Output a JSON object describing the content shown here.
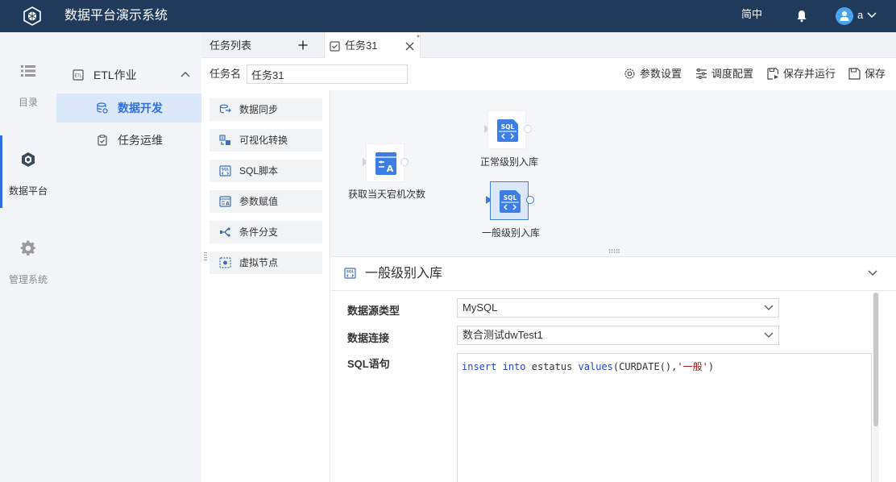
{
  "header": {
    "app_title": "数据平台演示系统",
    "language": "简中",
    "user_name": "a",
    "bg_color": "#1f3a5a"
  },
  "rail": {
    "items": [
      {
        "label": "目录",
        "icon": "list-icon",
        "active": false
      },
      {
        "label": "数据平台",
        "icon": "cube-icon",
        "active": true
      },
      {
        "label": "管理系统",
        "icon": "gear-icon",
        "active": false
      }
    ]
  },
  "sidebar": {
    "group_label": "ETL作业",
    "items": [
      {
        "label": "数据开发",
        "icon": "database-icon",
        "active": true
      },
      {
        "label": "任务运维",
        "icon": "clipboard-icon",
        "active": false
      }
    ]
  },
  "tabs": {
    "list_label": "任务列表",
    "active_tab_label": "任务31",
    "dirty_marker": "*"
  },
  "task": {
    "name_label": "任务名",
    "name_value": "任务31"
  },
  "toolbar": {
    "params_label": "参数设置",
    "schedule_label": "调度配置",
    "save_run_label": "保存并运行",
    "save_label": "保存"
  },
  "palette": {
    "items": [
      {
        "label": "数据同步",
        "icon": "sync-icon"
      },
      {
        "label": "可视化转换",
        "icon": "transform-icon"
      },
      {
        "label": "SQL脚本",
        "icon": "sql-icon"
      },
      {
        "label": "参数赋值",
        "icon": "param-assign-icon"
      },
      {
        "label": "条件分支",
        "icon": "branch-icon"
      },
      {
        "label": "虚拟节点",
        "icon": "virtual-node-icon"
      }
    ]
  },
  "canvas": {
    "nodes": [
      {
        "label": "获取当天宕机次数",
        "type": "param-assign",
        "selected": false
      },
      {
        "label": "正常级别入库",
        "type": "sql",
        "selected": false
      },
      {
        "label": "一般级别入库",
        "type": "sql",
        "selected": true
      }
    ]
  },
  "panel": {
    "title": "一般级别入库",
    "datasource_type_label": "数据源类型",
    "datasource_type_value": "MySQL",
    "connection_label": "数据连接",
    "connection_value": "数合测试dwTest1",
    "sql_label": "SQL语句",
    "sql_tokens": {
      "kw1": "insert",
      "kw2": "into",
      "table": "estatus",
      "kw3": "values",
      "call": "(CURDATE(),",
      "str": "'一般'",
      "close": ")"
    }
  },
  "colors": {
    "accent": "#2f6fe0",
    "active_bg": "#dbe8fa",
    "sidebar_bg": "#f3f5f8"
  }
}
